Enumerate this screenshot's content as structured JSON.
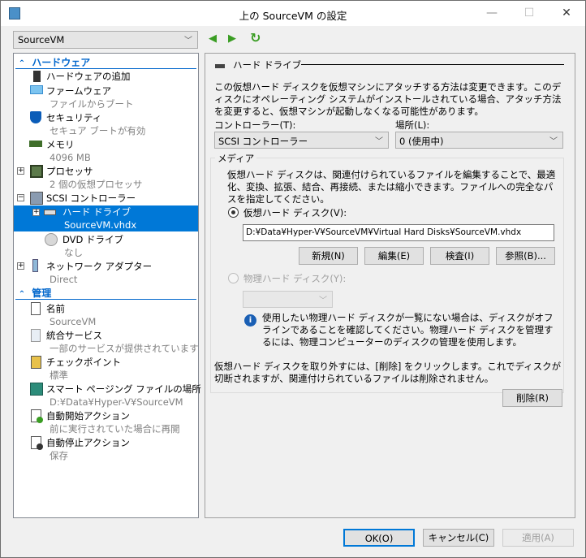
{
  "window": {
    "title": "上の SourceVM の設定",
    "minimize": "—",
    "maximize": "☐",
    "close": "✕"
  },
  "toolbar": {
    "vm_selected": "SourceVM"
  },
  "sidebar": {
    "hardware_header": "ハードウェア",
    "management_header": "管理",
    "items": [
      {
        "label": "ハードウェアの追加",
        "sub": ""
      },
      {
        "label": "ファームウェア",
        "sub": "ファイルからブート"
      },
      {
        "label": "セキュリティ",
        "sub": "セキュア ブートが有効"
      },
      {
        "label": "メモリ",
        "sub": "4096 MB"
      },
      {
        "label": "プロセッサ",
        "sub": "2 個の仮想プロセッサ"
      },
      {
        "label": "SCSI コントローラー",
        "sub": ""
      },
      {
        "label": "ハード ドライブ",
        "sub": "SourceVM.vhdx"
      },
      {
        "label": "DVD ドライブ",
        "sub": "なし"
      },
      {
        "label": "ネットワーク アダプター",
        "sub": "Direct"
      },
      {
        "label": "名前",
        "sub": "SourceVM"
      },
      {
        "label": "統合サービス",
        "sub": "一部のサービスが提供されています"
      },
      {
        "label": "チェックポイント",
        "sub": "標準"
      },
      {
        "label": "スマート ページング ファイルの場所",
        "sub": "D:¥Data¥Hyper-V¥SourceVM"
      },
      {
        "label": "自動開始アクション",
        "sub": "前に実行されていた場合に再開"
      },
      {
        "label": "自動停止アクション",
        "sub": "保存"
      }
    ]
  },
  "main": {
    "section_title": "ハード ドライブ",
    "intro": "この仮想ハード ディスクを仮想マシンにアタッチする方法は変更できます。このディスクにオペレーティング システムがインストールされている場合、アタッチ方法を変更すると、仮想マシンが起動しなくなる可能性があります。",
    "controller_label": "コントローラー(T):",
    "controller_value": "SCSI コントローラー",
    "location_label": "場所(L):",
    "location_value": "0 (使用中)",
    "media_label": "メディア",
    "media_desc": "仮想ハード ディスクは、関連付けられているファイルを編集することで、最適化、変換、拡張、結合、再接続、または縮小できます。ファイルへの完全なパスを指定してください。",
    "vhd_radio": "仮想ハード ディスク(V):",
    "vhd_path": "D:¥Data¥Hyper-V¥SourceVM¥Virtual Hard Disks¥SourceVM.vhdx",
    "new_btn": "新規(N)",
    "edit_btn": "編集(E)",
    "inspect_btn": "検査(I)",
    "browse_btn": "参照(B)...",
    "phys_radio": "物理ハード ディスク(Y):",
    "phys_info": "使用したい物理ハード ディスクが一覧にない場合は、ディスクがオフラインであることを確認してください。物理ハード ディスクを管理するには、物理コンピューターのディスクの管理を使用します。",
    "remove_desc": "仮想ハード ディスクを取り外すには、[削除] をクリックします。これでディスクが切断されますが、関連付けられているファイルは削除されません。",
    "remove_btn": "削除(R)"
  },
  "footer": {
    "ok": "OK(O)",
    "cancel": "キャンセル(C)",
    "apply": "適用(A)"
  }
}
